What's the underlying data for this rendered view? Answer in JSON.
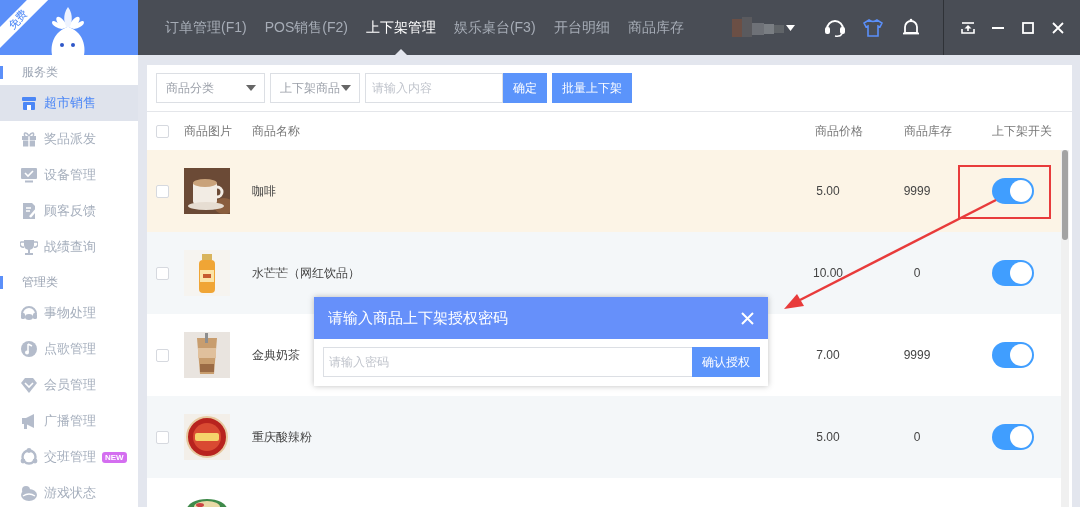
{
  "logo_ribbon": "免费",
  "nav_tabs": [
    {
      "label": "订单管理(F1)",
      "selected": false
    },
    {
      "label": "POS销售(F2)",
      "selected": false
    },
    {
      "label": "上下架管理",
      "selected": true
    },
    {
      "label": "娱乐桌台(F3)",
      "selected": false
    },
    {
      "label": "开台明细",
      "selected": false
    },
    {
      "label": "商品库存",
      "selected": false
    }
  ],
  "user_menu": {
    "avatar": {
      "kind": "picture"
    }
  },
  "sidebar": {
    "sections": [
      {
        "title": "服务类",
        "items": [
          {
            "label": "超市销售",
            "selected": true
          },
          {
            "label": "奖品派发",
            "selected": false
          },
          {
            "label": "设备管理",
            "selected": false
          },
          {
            "label": "顾客反馈",
            "selected": false
          },
          {
            "label": "战绩查询",
            "selected": false
          }
        ]
      },
      {
        "title": "管理类",
        "items": [
          {
            "label": "事物处理",
            "selected": false
          },
          {
            "label": "点歌管理",
            "selected": false
          },
          {
            "label": "会员管理",
            "selected": false
          },
          {
            "label": "广播管理",
            "selected": false
          },
          {
            "label": "交班管理",
            "selected": false,
            "badge": "NEW"
          },
          {
            "label": "游戏状态",
            "selected": false
          }
        ]
      }
    ]
  },
  "filters": {
    "category_select": "商品分类",
    "status_select": "上下架商品",
    "search": {
      "placeholder": "请输入内容"
    },
    "buttons": [
      "确定",
      "批量上下架"
    ]
  },
  "table": {
    "header_checked": false,
    "columns": [
      "商品图片",
      "商品名称",
      "商品价格",
      "商品库存",
      "上下架开关"
    ],
    "rows": [
      {
        "image": {
          "kind": "picture"
        },
        "name": "咖啡",
        "price": "5.00",
        "stock": "9999",
        "on": true,
        "checked": false,
        "highlighted": true
      },
      {
        "image": {
          "kind": "picture"
        },
        "name": "水芒芒（网红饮品）",
        "price": "10.00",
        "stock": "0",
        "on": true,
        "checked": false,
        "highlighted": false
      },
      {
        "image": {
          "kind": "picture"
        },
        "name": "金典奶茶",
        "price": "7.00",
        "stock": "9999",
        "on": true,
        "checked": false,
        "highlighted": false
      },
      {
        "image": {
          "kind": "picture"
        },
        "name": "重庆酸辣粉",
        "price": "5.00",
        "stock": "0",
        "on": true,
        "checked": false,
        "highlighted": false
      }
    ],
    "partial_row": {
      "image": {
        "kind": "picture"
      }
    }
  },
  "dialog": {
    "title": "请输入商品上下架授权密码",
    "placeholder": "请输入密码",
    "button": "确认授权"
  }
}
